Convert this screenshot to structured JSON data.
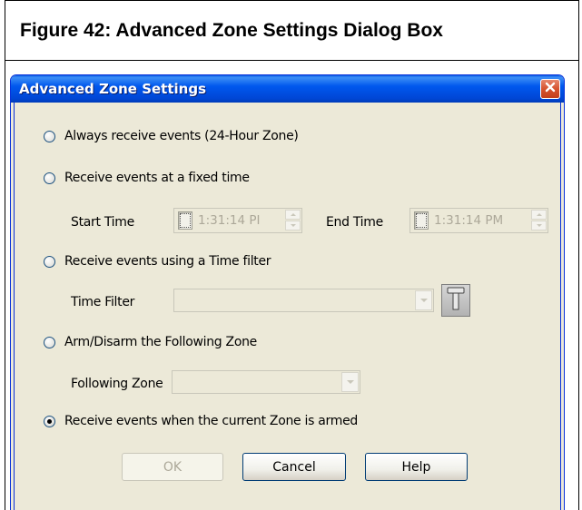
{
  "figure": {
    "caption": "Figure 42:  Advanced Zone Settings Dialog Box"
  },
  "dialog": {
    "title": "Advanced Zone Settings",
    "close_icon": "close-icon"
  },
  "options": {
    "always": {
      "label": "Always receive events (24-Hour Zone)",
      "checked": false
    },
    "fixed_time": {
      "label": "Receive events at a fixed time",
      "checked": false
    },
    "time_filter": {
      "label": "Receive events using a Time filter",
      "checked": false
    },
    "arm_disarm": {
      "label": "Arm/Disarm the Following Zone",
      "checked": false
    },
    "when_armed": {
      "label": "Receive events when the current Zone is armed",
      "checked": true
    }
  },
  "fixed_time": {
    "start_label": "Start Time",
    "start_value": "1:31:14 PI",
    "end_label": "End Time",
    "end_value": "1:31:14 PM"
  },
  "time_filter": {
    "label": "Time Filter",
    "value": "",
    "tool_icon": "hammer-icon"
  },
  "following_zone": {
    "label": "Following Zone",
    "value": ""
  },
  "buttons": {
    "ok": "OK",
    "cancel": "Cancel",
    "help": "Help"
  }
}
